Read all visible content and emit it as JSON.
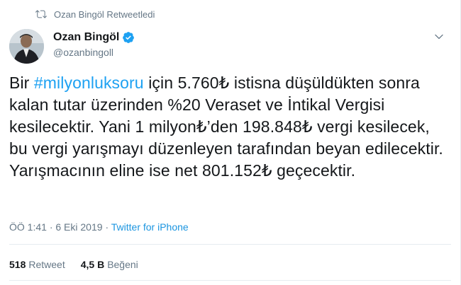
{
  "retweet_context": {
    "icon": "retweet-icon",
    "text": "Ozan Bingöl Retweetledi"
  },
  "author": {
    "display_name": "Ozan Bingöl",
    "handle": "@ozanbingoll",
    "verified": true,
    "verified_color": "#1da1f2"
  },
  "tweet": {
    "text_part1": "Bir ",
    "hashtag": "#milyonluksoru",
    "text_part2": " için 5.760₺ istisna düşüldükten sonra kalan tutar üzerinden %20 Veraset ve İntikal Vergisi kesilecektir. Yani 1 milyon₺’den 198.848₺ vergi kesilecek, bu vergi yarışmayı düzenleyen tarafından beyan edilecektir. Yarışmacının eline ise net 801.152₺ geçecektir."
  },
  "meta": {
    "time": "ÖÖ 1:41",
    "separator": "·",
    "date": "6 Eki 2019",
    "separator2": "·",
    "source": "Twitter for iPhone"
  },
  "stats": {
    "retweets_count": "518",
    "retweets_label": "Retweet",
    "likes_count": "4,5 B",
    "likes_label": "Beğeni"
  },
  "colors": {
    "link": "#1da1f2",
    "muted": "#657786",
    "text": "#14171a",
    "border": "#e6ecf0"
  }
}
